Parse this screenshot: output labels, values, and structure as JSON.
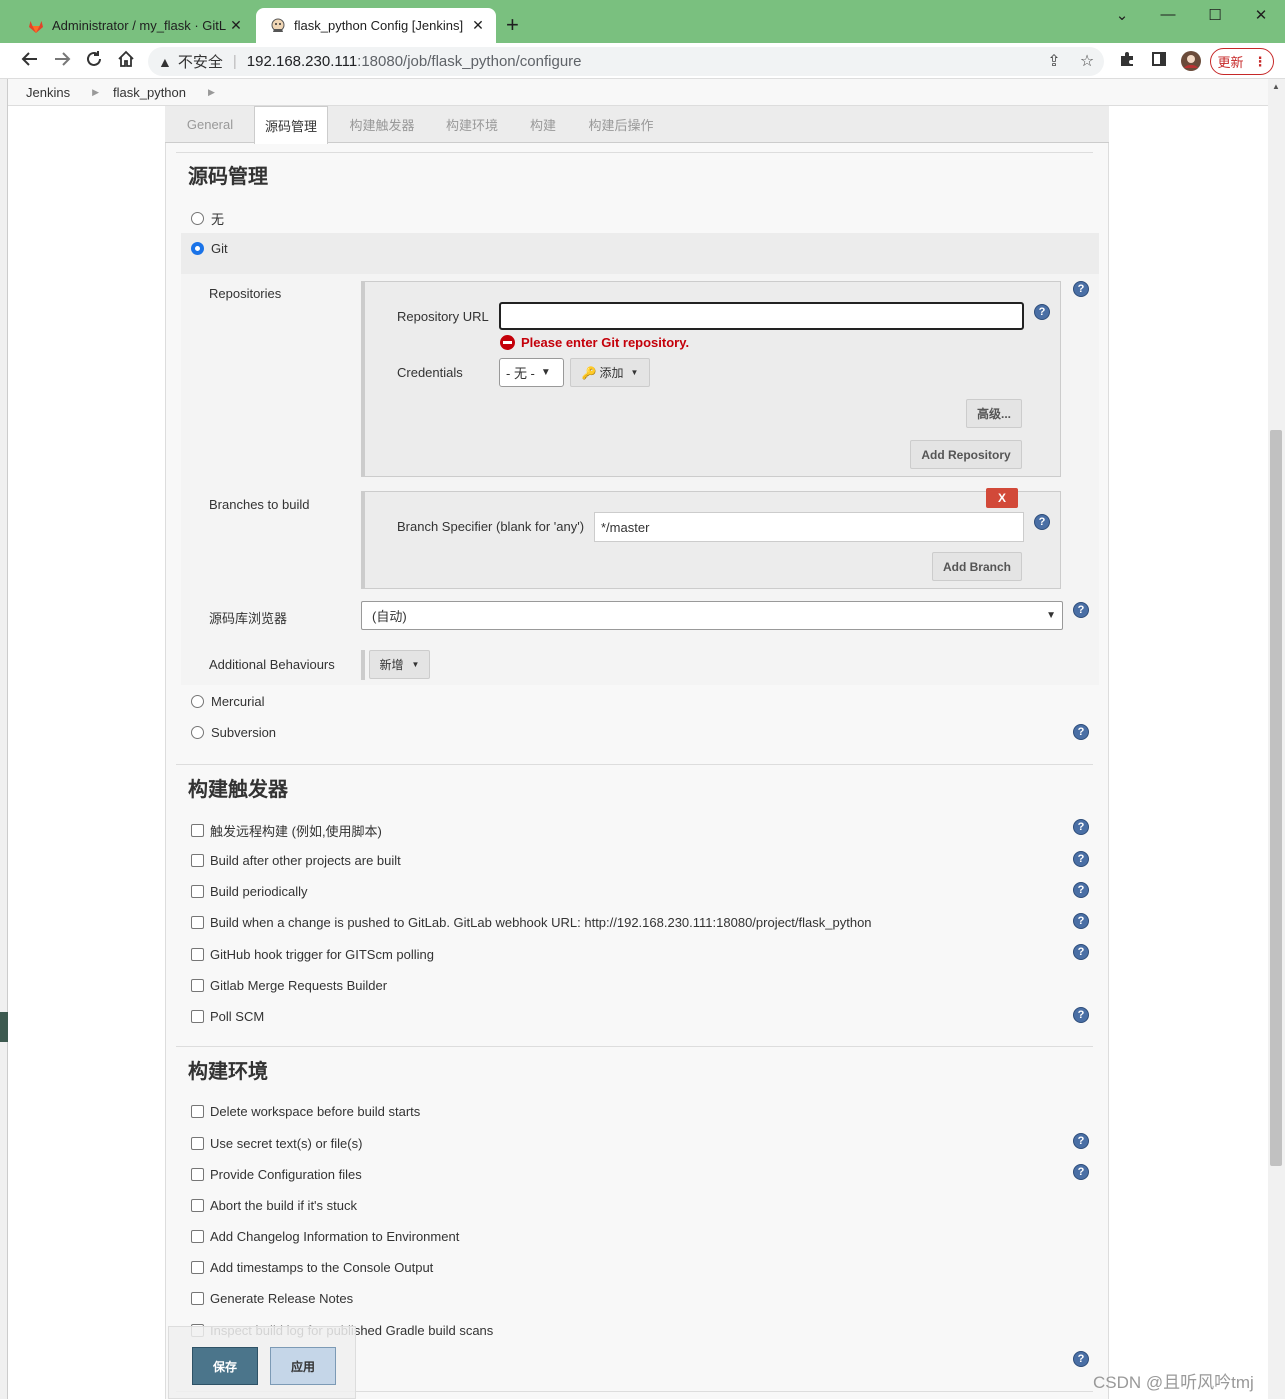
{
  "browser": {
    "tabs": [
      {
        "title": "Administrator / my_flask · GitLab",
        "close": "✕"
      },
      {
        "title": "flask_python Config [Jenkins]",
        "close": "✕"
      }
    ],
    "new_tab": "+",
    "window_controls": {
      "minimize": "⌄",
      "min": "—",
      "max": "☐",
      "close": "✕"
    },
    "address": {
      "security_label": "不安全",
      "host": "192.168.230.111",
      "path": ":18080/job/flask_python/configure"
    },
    "update_button": "更新",
    "icons": {
      "back": "arrow-left-icon",
      "forward": "arrow-right-icon",
      "reload": "reload-icon",
      "home": "home-icon",
      "share": "share-icon",
      "star": "star-icon",
      "extensions": "puzzle-icon",
      "sidepanel": "sidepanel-icon",
      "profile": "avatar-icon",
      "menu": "kebab-menu-icon"
    }
  },
  "breadcrumb": [
    "Jenkins",
    "flask_python"
  ],
  "config_tabs": [
    "General",
    "源码管理",
    "构建触发器",
    "构建环境",
    "构建",
    "构建后操作"
  ],
  "active_tab": "源码管理",
  "scm": {
    "heading": "源码管理",
    "none_label": "无",
    "git_label": "Git",
    "repositories_label": "Repositories",
    "repo_url_label": "Repository URL",
    "repo_url_value": "",
    "repo_error": "Please enter Git repository.",
    "credentials_label": "Credentials",
    "credentials_value": "- 无 -",
    "add_label": "添加",
    "advanced_button": "高级...",
    "add_repository_button": "Add Repository",
    "branches_label": "Branches to build",
    "delete_button": "X",
    "branch_specifier_label": "Branch Specifier (blank for 'any')",
    "branch_specifier_value": "*/master",
    "add_branch_button": "Add Branch",
    "browser_label": "源码库浏览器",
    "browser_value": "(自动)",
    "behaviours_label": "Additional Behaviours",
    "behaviours_button": "新增",
    "mercurial_label": "Mercurial",
    "subversion_label": "Subversion"
  },
  "triggers": {
    "heading": "构建触发器",
    "items": [
      "触发远程构建 (例如,使用脚本)",
      "Build after other projects are built",
      "Build periodically",
      "Build when a change is pushed to GitLab. GitLab webhook URL: http://192.168.230.111:18080/project/flask_python",
      "GitHub hook trigger for GITScm polling",
      "Gitlab Merge Requests Builder",
      "Poll SCM"
    ]
  },
  "environment": {
    "heading": "构建环境",
    "items": [
      "Delete workspace before build starts",
      "Use secret text(s) or file(s)",
      "Provide Configuration files",
      "Abort the build if it's stuck",
      "Add Changelog Information to Environment",
      "Add timestamps to the Console Output",
      "Generate Release Notes",
      "Inspect build log for published Gradle build scans"
    ]
  },
  "footer": {
    "save": "保存",
    "apply": "应用"
  },
  "help_glyph": "?",
  "watermark": "CSDN @且听风吟tmj",
  "colors": {
    "chrome_green": "#7ac07f",
    "error_red": "#c4000a",
    "save_blue": "#4b758b",
    "delete_red": "#d24939"
  }
}
